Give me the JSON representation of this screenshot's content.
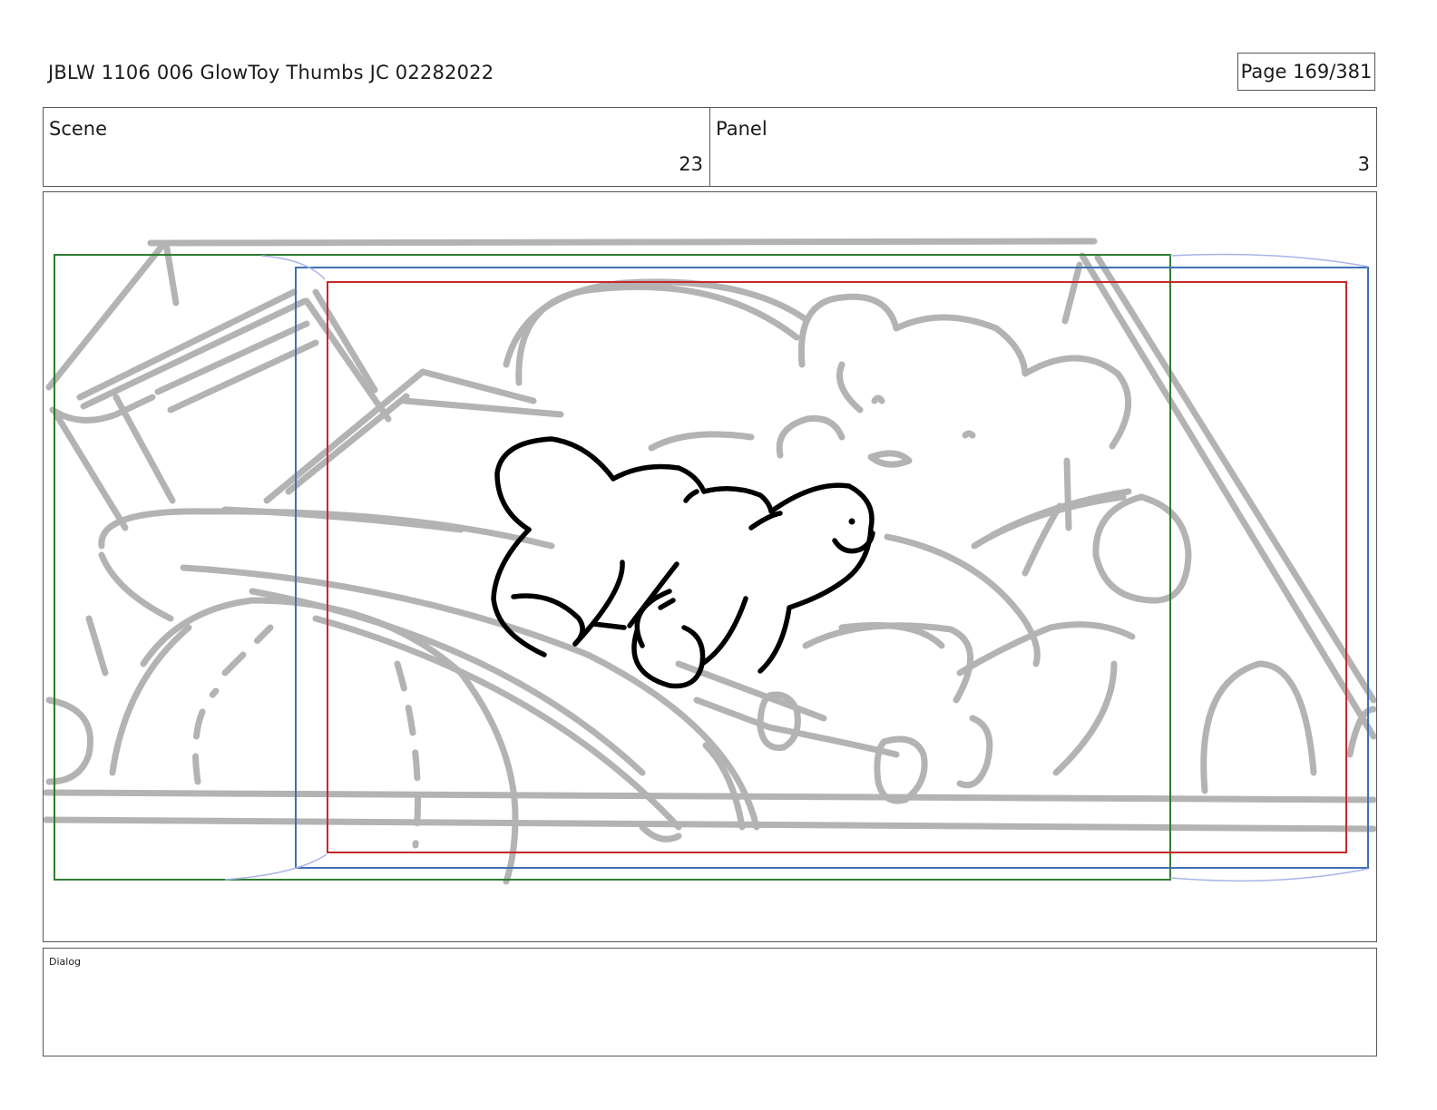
{
  "header": {
    "title": "JBLW 1106 006 GlowToy Thumbs JC 02282022",
    "page": "Page 169/381"
  },
  "info": {
    "scene_label": "Scene",
    "scene_value": "23",
    "panel_label": "Panel",
    "panel_value": "3"
  },
  "dialog": {
    "label": "Dialog"
  },
  "colors": {
    "camera_frame_green": "#2e7d32",
    "camera_frame_blue": "#3f6fb5",
    "camera_frame_red": "#c62828",
    "sketch_gray": "#b3b3b3",
    "ink": "#000000"
  }
}
